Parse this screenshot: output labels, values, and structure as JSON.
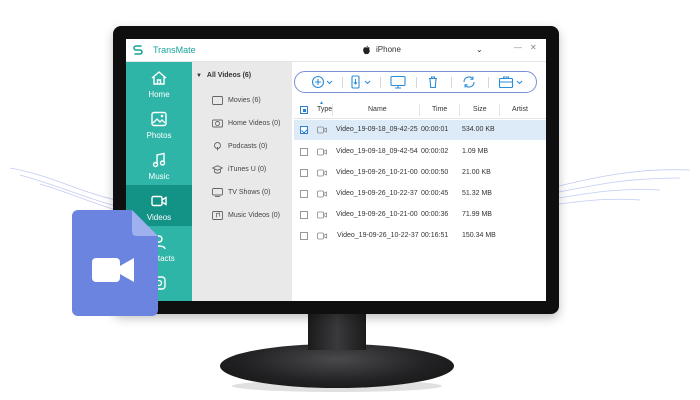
{
  "app": {
    "name": "TransMate"
  },
  "device": {
    "name": "iPhone"
  },
  "nav": [
    {
      "label": "Home",
      "icon": "home-icon"
    },
    {
      "label": "Photos",
      "icon": "photos-icon"
    },
    {
      "label": "Music",
      "icon": "music-icon"
    },
    {
      "label": "Videos",
      "icon": "video-icon",
      "active": true
    },
    {
      "label": "Contacts",
      "icon": "contacts-icon"
    },
    {
      "label": "",
      "icon": "messages-icon"
    }
  ],
  "categories": {
    "header": "All Videos (6)",
    "items": [
      {
        "label": "Movies (6)",
        "icon": "movie-icon"
      },
      {
        "label": "Home Videos (0)",
        "icon": "home-video-icon"
      },
      {
        "label": "Podcasts (0)",
        "icon": "podcast-icon"
      },
      {
        "label": "iTunes U (0)",
        "icon": "itunes-u-icon"
      },
      {
        "label": "TV Shows (0)",
        "icon": "tv-icon"
      },
      {
        "label": "Music Videos (0)",
        "icon": "music-video-icon"
      }
    ]
  },
  "toolbar": [
    "add-icon",
    "export-to-device-icon",
    "export-to-pc-icon",
    "delete-icon",
    "refresh-icon",
    "toolbox-icon"
  ],
  "table": {
    "columns": {
      "type": "Type",
      "name": "Name",
      "time": "Time",
      "size": "Size",
      "artist": "Artist"
    },
    "rows": [
      {
        "name": "Video_19-09-18_09-42-25",
        "time": "00:00:01",
        "size": "534.00 KB",
        "selected": true
      },
      {
        "name": "Video_19-09-18_09-42-54",
        "time": "00:00:02",
        "size": "1.09 MB",
        "selected": false
      },
      {
        "name": "Video_19-09-26_10-21-00",
        "time": "00:00:50",
        "size": "21.00 KB",
        "selected": false
      },
      {
        "name": "Video_19-09-26_10-22-37",
        "time": "00:00:45",
        "size": "51.32 MB",
        "selected": false
      },
      {
        "name": "Video_19-09-26_10-21-00",
        "time": "00:00:36",
        "size": "71.99 MB",
        "selected": false
      },
      {
        "name": "Video_19-09-26_10-22-37",
        "time": "00:16:51",
        "size": "150.34 MB",
        "selected": false
      }
    ]
  },
  "colors": {
    "nav": "#2eb5a7",
    "nav_active": "#139286",
    "accent": "#1aa39a",
    "toolbar_border": "#7b8fd8",
    "file_icon": "#6b84e0",
    "selected_row": "#dcebf7"
  }
}
